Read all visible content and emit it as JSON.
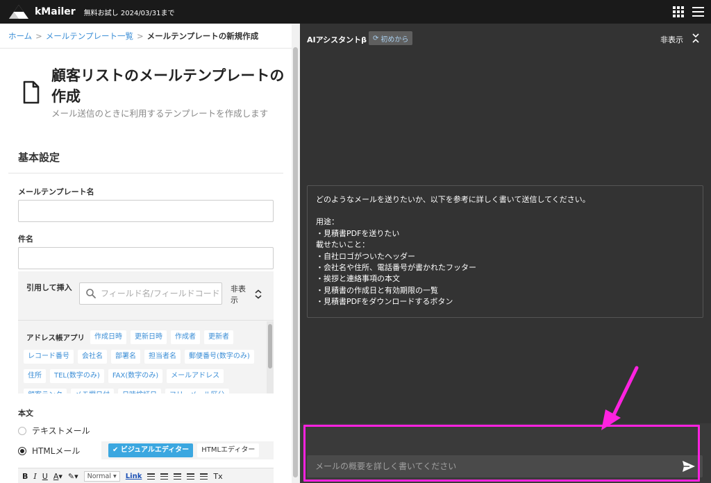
{
  "topbar": {
    "brand": "kMailer",
    "trial_text": "無料お試し 2024/03/31まで",
    "apps_icon": "grid-icon",
    "menu_icon": "hamburger-menu-icon"
  },
  "breadcrumb": {
    "home": "ホーム",
    "list": "メールテンプレート一覧",
    "current": "メールテンプレートの新規作成",
    "separator": ">"
  },
  "page": {
    "title": "顧客リストのメールテンプレートの作成",
    "subtitle": "メール送信のときに利用するテンプレートを作成します",
    "icon": "document-icon"
  },
  "basic_settings": {
    "section_title": "基本設定",
    "template_name_label": "メールテンプレート名",
    "template_name_value": "",
    "subject_label": "件名",
    "subject_value": ""
  },
  "insert_fields": {
    "label": "引用して挿入",
    "search_placeholder": "フィールド名/フィールドコード",
    "hide_label": "非表示",
    "app_name": "アドレス帳アプリ",
    "rows": [
      [
        "作成日時",
        "更新日時",
        "作成者",
        "更新者"
      ],
      [
        "レコード番号",
        "会社名",
        "部署名",
        "担当者名",
        "郵便番号(数字のみ)"
      ],
      [
        "住所",
        "TEL(数字のみ)",
        "FAX(数字のみ)",
        "メールアドレス"
      ],
      [
        "顧客ランク",
        "メモ欄日付",
        "日時検証日",
        "フリーメール区分"
      ]
    ]
  },
  "body_section": {
    "label": "本文",
    "radio_text": "テキストメール",
    "radio_html": "HTMLメール",
    "selected": "HTMLメール",
    "visual_editor": "ビジュアルエディター",
    "html_editor": "HTMLエディター"
  },
  "toolbar": {
    "bold": "B",
    "italic": "I",
    "underline": "U",
    "font_color": "A",
    "font_size": "Normal",
    "link": "Link",
    "clear_format": "Tx"
  },
  "ai_panel": {
    "title": "AIアシスタントβ",
    "restart": "初めから",
    "hide": "非表示",
    "message_lines": [
      "どのようなメールを送りたいか、以下を参考に詳しく書いて送信してください。",
      "",
      "用途：",
      "・見積書PDFを送りたい",
      "載せたいこと：",
      "・自社ロゴがついたヘッダー",
      "・会社名や住所、電話番号が書かれたフッター",
      "・挨拶と連絡事項の本文",
      "・見積書の作成日と有効期限の一覧",
      "・見積書PDFをダウンロードするボタン"
    ],
    "input_placeholder": "メールの概要を詳しく書いてください",
    "input_value": "",
    "send_icon": "send-icon",
    "highlight_color": "#ff22e0"
  },
  "colors": {
    "topbar_bg": "#1a1a1a",
    "link": "#3b8ed6",
    "ai_panel_bg": "#333333",
    "active_button": "#3ba7e0",
    "annotation": "#ff22e0"
  }
}
